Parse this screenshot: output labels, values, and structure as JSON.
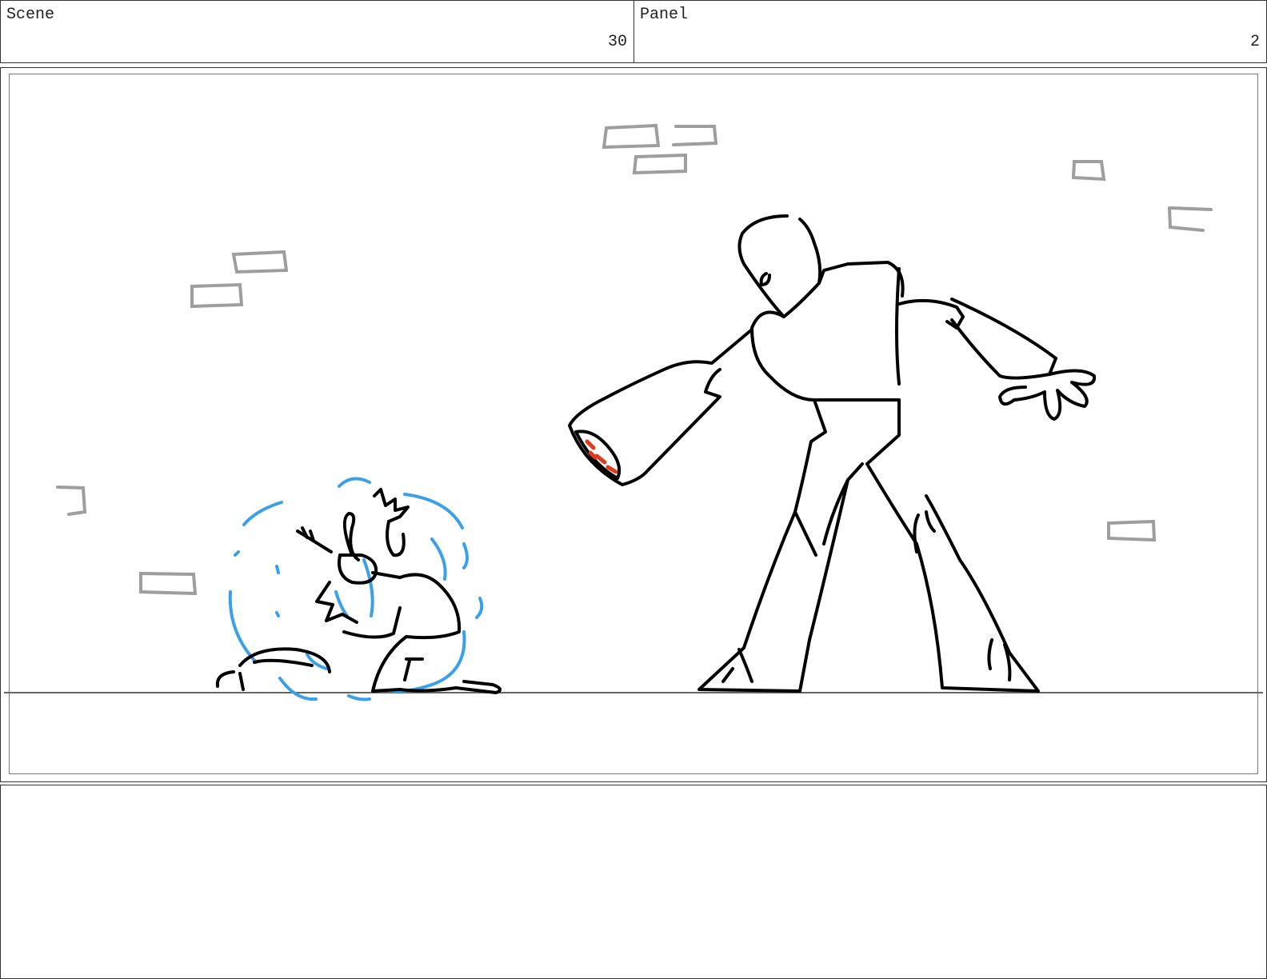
{
  "header": {
    "scene_label": "Scene",
    "scene_number": "30",
    "panel_label": "Panel",
    "panel_number": "2"
  },
  "drawing": {
    "line_color": "#000000",
    "brick_color": "#9e9e9e",
    "effect_color": "#3aa0e8",
    "accent_color": "#e03a1e",
    "floor_color": "#666666"
  },
  "notes": {
    "text": ""
  }
}
